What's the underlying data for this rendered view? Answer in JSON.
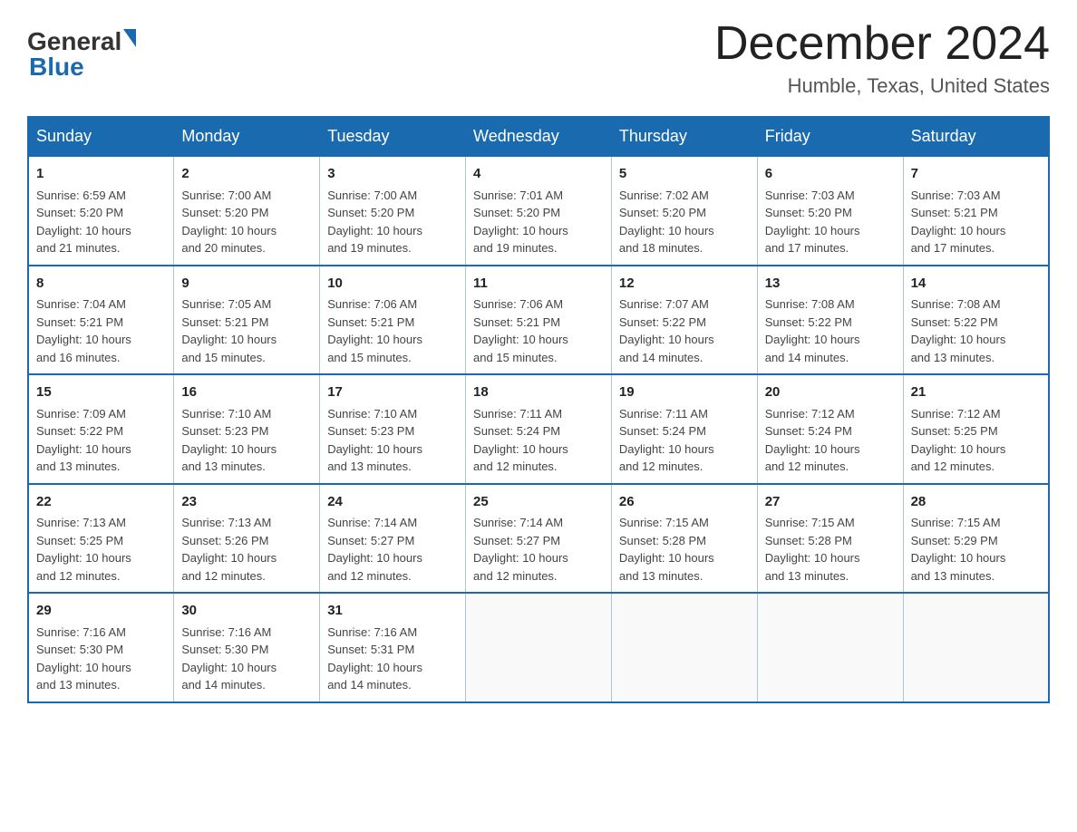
{
  "logo": {
    "text_general": "General",
    "text_blue": "Blue"
  },
  "title": "December 2024",
  "location": "Humble, Texas, United States",
  "headers": [
    "Sunday",
    "Monday",
    "Tuesday",
    "Wednesday",
    "Thursday",
    "Friday",
    "Saturday"
  ],
  "weeks": [
    [
      {
        "day": "1",
        "info": "Sunrise: 6:59 AM\nSunset: 5:20 PM\nDaylight: 10 hours\nand 21 minutes."
      },
      {
        "day": "2",
        "info": "Sunrise: 7:00 AM\nSunset: 5:20 PM\nDaylight: 10 hours\nand 20 minutes."
      },
      {
        "day": "3",
        "info": "Sunrise: 7:00 AM\nSunset: 5:20 PM\nDaylight: 10 hours\nand 19 minutes."
      },
      {
        "day": "4",
        "info": "Sunrise: 7:01 AM\nSunset: 5:20 PM\nDaylight: 10 hours\nand 19 minutes."
      },
      {
        "day": "5",
        "info": "Sunrise: 7:02 AM\nSunset: 5:20 PM\nDaylight: 10 hours\nand 18 minutes."
      },
      {
        "day": "6",
        "info": "Sunrise: 7:03 AM\nSunset: 5:20 PM\nDaylight: 10 hours\nand 17 minutes."
      },
      {
        "day": "7",
        "info": "Sunrise: 7:03 AM\nSunset: 5:21 PM\nDaylight: 10 hours\nand 17 minutes."
      }
    ],
    [
      {
        "day": "8",
        "info": "Sunrise: 7:04 AM\nSunset: 5:21 PM\nDaylight: 10 hours\nand 16 minutes."
      },
      {
        "day": "9",
        "info": "Sunrise: 7:05 AM\nSunset: 5:21 PM\nDaylight: 10 hours\nand 15 minutes."
      },
      {
        "day": "10",
        "info": "Sunrise: 7:06 AM\nSunset: 5:21 PM\nDaylight: 10 hours\nand 15 minutes."
      },
      {
        "day": "11",
        "info": "Sunrise: 7:06 AM\nSunset: 5:21 PM\nDaylight: 10 hours\nand 15 minutes."
      },
      {
        "day": "12",
        "info": "Sunrise: 7:07 AM\nSunset: 5:22 PM\nDaylight: 10 hours\nand 14 minutes."
      },
      {
        "day": "13",
        "info": "Sunrise: 7:08 AM\nSunset: 5:22 PM\nDaylight: 10 hours\nand 14 minutes."
      },
      {
        "day": "14",
        "info": "Sunrise: 7:08 AM\nSunset: 5:22 PM\nDaylight: 10 hours\nand 13 minutes."
      }
    ],
    [
      {
        "day": "15",
        "info": "Sunrise: 7:09 AM\nSunset: 5:22 PM\nDaylight: 10 hours\nand 13 minutes."
      },
      {
        "day": "16",
        "info": "Sunrise: 7:10 AM\nSunset: 5:23 PM\nDaylight: 10 hours\nand 13 minutes."
      },
      {
        "day": "17",
        "info": "Sunrise: 7:10 AM\nSunset: 5:23 PM\nDaylight: 10 hours\nand 13 minutes."
      },
      {
        "day": "18",
        "info": "Sunrise: 7:11 AM\nSunset: 5:24 PM\nDaylight: 10 hours\nand 12 minutes."
      },
      {
        "day": "19",
        "info": "Sunrise: 7:11 AM\nSunset: 5:24 PM\nDaylight: 10 hours\nand 12 minutes."
      },
      {
        "day": "20",
        "info": "Sunrise: 7:12 AM\nSunset: 5:24 PM\nDaylight: 10 hours\nand 12 minutes."
      },
      {
        "day": "21",
        "info": "Sunrise: 7:12 AM\nSunset: 5:25 PM\nDaylight: 10 hours\nand 12 minutes."
      }
    ],
    [
      {
        "day": "22",
        "info": "Sunrise: 7:13 AM\nSunset: 5:25 PM\nDaylight: 10 hours\nand 12 minutes."
      },
      {
        "day": "23",
        "info": "Sunrise: 7:13 AM\nSunset: 5:26 PM\nDaylight: 10 hours\nand 12 minutes."
      },
      {
        "day": "24",
        "info": "Sunrise: 7:14 AM\nSunset: 5:27 PM\nDaylight: 10 hours\nand 12 minutes."
      },
      {
        "day": "25",
        "info": "Sunrise: 7:14 AM\nSunset: 5:27 PM\nDaylight: 10 hours\nand 12 minutes."
      },
      {
        "day": "26",
        "info": "Sunrise: 7:15 AM\nSunset: 5:28 PM\nDaylight: 10 hours\nand 13 minutes."
      },
      {
        "day": "27",
        "info": "Sunrise: 7:15 AM\nSunset: 5:28 PM\nDaylight: 10 hours\nand 13 minutes."
      },
      {
        "day": "28",
        "info": "Sunrise: 7:15 AM\nSunset: 5:29 PM\nDaylight: 10 hours\nand 13 minutes."
      }
    ],
    [
      {
        "day": "29",
        "info": "Sunrise: 7:16 AM\nSunset: 5:30 PM\nDaylight: 10 hours\nand 13 minutes."
      },
      {
        "day": "30",
        "info": "Sunrise: 7:16 AM\nSunset: 5:30 PM\nDaylight: 10 hours\nand 14 minutes."
      },
      {
        "day": "31",
        "info": "Sunrise: 7:16 AM\nSunset: 5:31 PM\nDaylight: 10 hours\nand 14 minutes."
      },
      {
        "day": "",
        "info": ""
      },
      {
        "day": "",
        "info": ""
      },
      {
        "day": "",
        "info": ""
      },
      {
        "day": "",
        "info": ""
      }
    ]
  ]
}
